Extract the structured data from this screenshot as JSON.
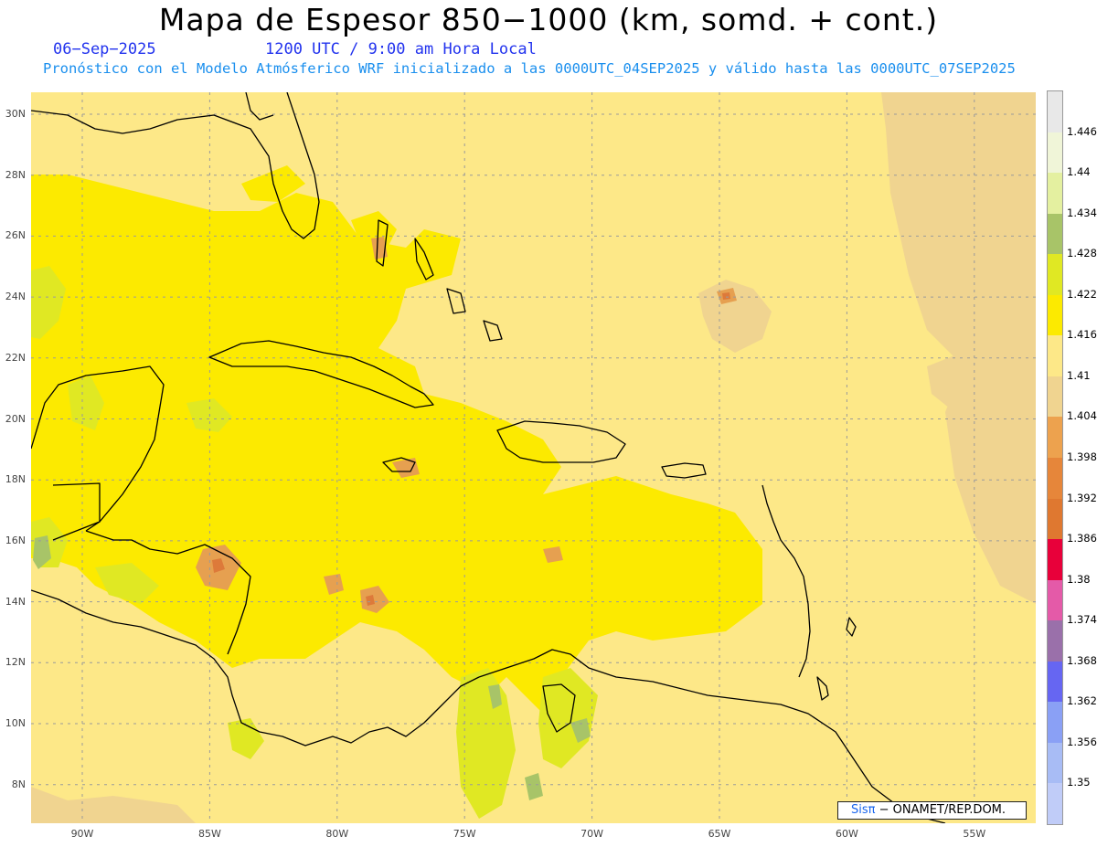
{
  "header": {
    "title": "Mapa de Espesor 850−1000 (km, somd. + cont.)",
    "date": "06−Sep−2025",
    "time": "1200 UTC / 9:00 am Hora Local",
    "forecast": "Pronóstico con el Modelo Atmósferico WRF inicializado a las 0000UTC_04SEP2025 y válido hasta las  0000UTC_07SEP2025"
  },
  "map": {
    "lat_labels": [
      "30N",
      "28N",
      "26N",
      "24N",
      "22N",
      "20N",
      "18N",
      "16N",
      "14N",
      "12N",
      "10N",
      "8N"
    ],
    "lon_labels": [
      "90W",
      "85W",
      "80W",
      "75W",
      "70W",
      "65W",
      "60W",
      "55W"
    ],
    "colors": {
      "base": "#fde888",
      "light_tan": "#f0d490",
      "tan": "#e8c58a",
      "bright_yellow": "#fcea00",
      "yellow_green": "#e0e823",
      "lime": "#c2dc64",
      "green": "#a8c468",
      "orange": "#e6a050",
      "dark_orange": "#dd7a3a",
      "coast": "#000000",
      "grid": "#9a9a9a"
    }
  },
  "legend": {
    "labels": [
      "1.446",
      "1.44",
      "1.434",
      "1.428",
      "1.422",
      "1.416",
      "1.41",
      "1.404",
      "1.398",
      "1.392",
      "1.386",
      "1.38",
      "1.374",
      "1.368",
      "1.362",
      "1.356",
      "1.35"
    ],
    "colors": [
      "#e8e8e8",
      "#f0f5d8",
      "#e4f0a0",
      "#a8c468",
      "#e0e823",
      "#fcea00",
      "#fde888",
      "#f0d490",
      "#eda24e",
      "#e6863a",
      "#df7830",
      "#e8003a",
      "#e45aa8",
      "#9a70aa",
      "#6666f2",
      "#8aa0f5",
      "#a8bcf5",
      "#c0ccf8"
    ]
  },
  "credit": {
    "brand": "Sisπ",
    "separator": " − ",
    "org": "ONAMET/REP.DOM."
  }
}
